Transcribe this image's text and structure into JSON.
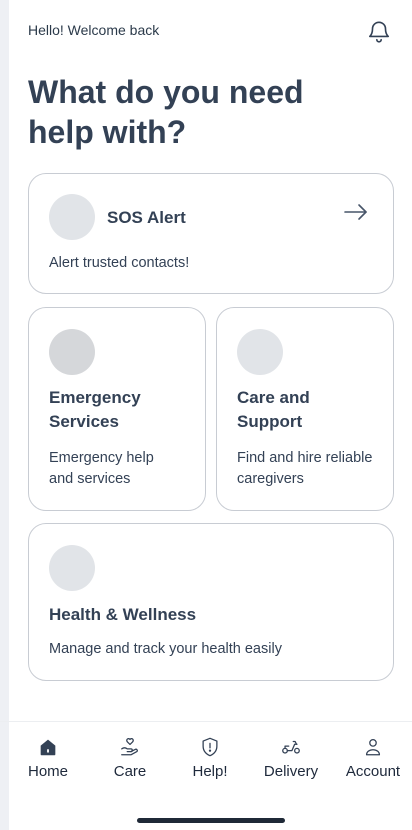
{
  "header": {
    "greeting": "Hello! Welcome back",
    "bell_icon": "bell-icon",
    "headline": "What do you need help with?"
  },
  "cards": {
    "sos": {
      "title": "SOS Alert",
      "description": "Alert trusted contacts!",
      "icon": "arrow-right-icon"
    },
    "emergency": {
      "title": "Emergency Services",
      "description": "Emergency help and services"
    },
    "care": {
      "title": "Care and Support",
      "description": "Find and hire reliable caregivers"
    },
    "health": {
      "title": "Health & Wellness",
      "description": "Manage and track your health easily"
    }
  },
  "bottom_nav": {
    "items": [
      {
        "label": "Home",
        "icon": "home-icon",
        "active": true
      },
      {
        "label": "Care",
        "icon": "care-hand-icon"
      },
      {
        "label": "Help!",
        "icon": "shield-alert-icon"
      },
      {
        "label": "Delivery",
        "icon": "scooter-icon"
      },
      {
        "label": "Account",
        "icon": "user-icon"
      }
    ]
  },
  "colors": {
    "text": "#334155",
    "border": "#c8ccd3",
    "placeholder_circle": "#e1e4e8",
    "nav_active": "#334155"
  }
}
